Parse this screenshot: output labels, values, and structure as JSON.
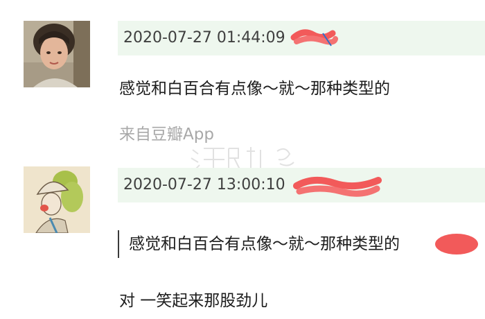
{
  "comments": [
    {
      "timestamp": "2020-07-27 01:44:09",
      "text": "感觉和白百合有点像～就～那种类型的",
      "source": "来自豆瓣App",
      "avatar_icon": "avatar-photo-short-hair"
    },
    {
      "timestamp": "2020-07-27 13:00:10",
      "quoted_text": "感觉和白百合有点像～就～那种类型的",
      "text": "对 一笑起来那股劲儿",
      "avatar_icon": "avatar-illustration-hat"
    }
  ],
  "colors": {
    "meta_bar_bg": "#eef7ee",
    "redaction": "#f25a5a",
    "source_text": "#a8a8a8"
  }
}
